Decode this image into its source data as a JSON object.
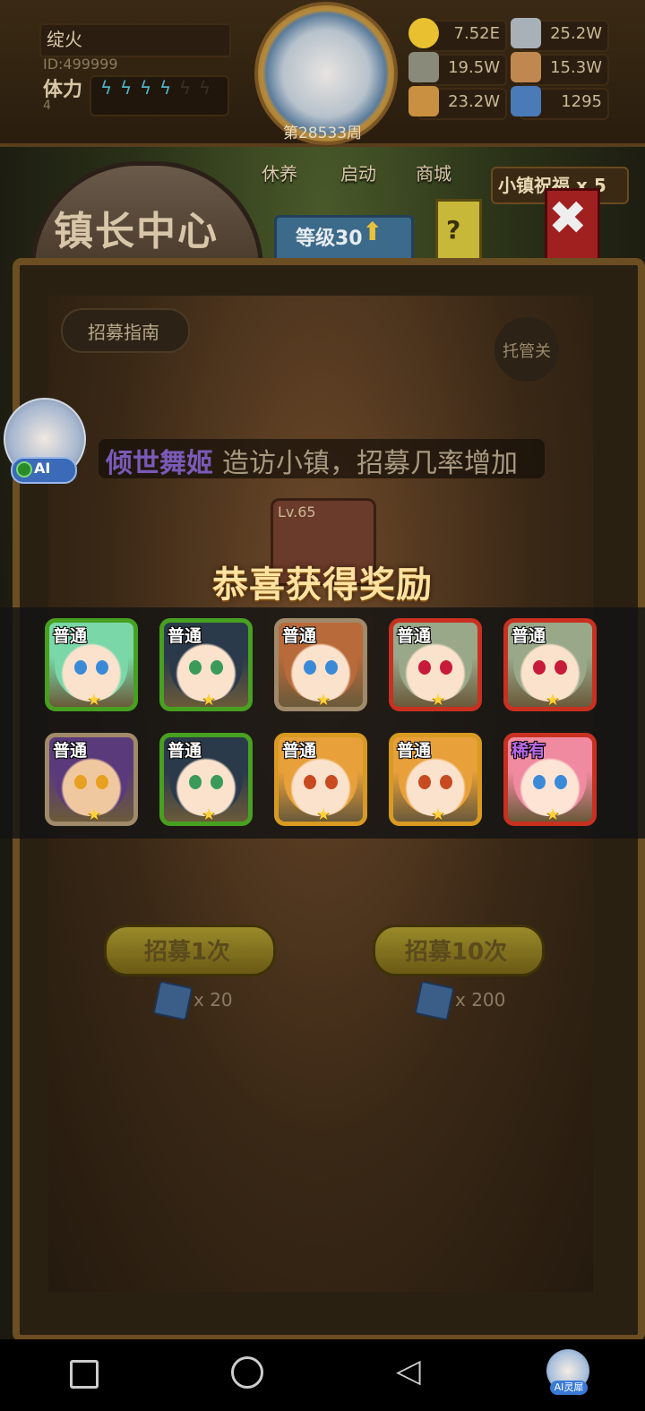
{
  "player": {
    "name": "绽火",
    "id": "ID:499999",
    "stamina_label": "体力",
    "stamina_value": "4",
    "stamina_bolts": 4,
    "stamina_max": 6
  },
  "week": "第28533周",
  "resources": [
    {
      "icon": "gold-coin-icon",
      "value": "7.52E"
    },
    {
      "icon": "steel-ingot-icon",
      "value": "25.2W"
    },
    {
      "icon": "stone-ore-icon",
      "value": "19.5W"
    },
    {
      "icon": "leather-icon",
      "value": "15.3W"
    },
    {
      "icon": "wood-log-icon",
      "value": "23.2W"
    },
    {
      "icon": "blue-gem-icon",
      "value": "1295"
    }
  ],
  "menu": {
    "tabs": [
      "休养",
      "启动",
      "商城"
    ],
    "blessing": "小镇祝福 x 5"
  },
  "panel": {
    "title": "镇长中心",
    "level": "等级30",
    "help": "?",
    "close": "✖",
    "guide": "招募指南",
    "auto": "托管关",
    "banner_hero": "倾世舞姬",
    "banner_text": "造访小镇，招募几率增加",
    "hero_level": "Lv.65",
    "recruit_once": "招募1次",
    "recruit_ten": "招募10次",
    "cost_once": "x 20",
    "cost_ten": "x 200"
  },
  "ai_badge": "AI",
  "reward": {
    "title": "恭喜获得奖励",
    "items": [
      {
        "rarity": "普通",
        "frame": "#48a020",
        "hair": "#7ad8a8",
        "eye": "#3a8ad8",
        "skin": "#fbe2cc",
        "stars": "★"
      },
      {
        "rarity": "普通",
        "frame": "#48a020",
        "hair": "#2a3a4a",
        "eye": "#3a9a5a",
        "skin": "#fbe2cc",
        "stars": "★"
      },
      {
        "rarity": "普通",
        "frame": "#a08a6a",
        "hair": "#b86a3a",
        "eye": "#3a8ad8",
        "skin": "#fbe2cc",
        "stars": "★"
      },
      {
        "rarity": "普通",
        "frame": "#c83020",
        "hair": "#9aa88a",
        "eye": "#c81a3a",
        "skin": "#fbe2cc",
        "stars": "★"
      },
      {
        "rarity": "普通",
        "frame": "#c83020",
        "hair": "#9aa88a",
        "eye": "#c81a3a",
        "skin": "#fbe2cc",
        "stars": "★"
      },
      {
        "rarity": "普通",
        "frame": "#a08a6a",
        "hair": "#5a3a7a",
        "eye": "#e8a020",
        "skin": "#f0c8a0",
        "stars": "★"
      },
      {
        "rarity": "普通",
        "frame": "#48a020",
        "hair": "#2a3a4a",
        "eye": "#3a9a5a",
        "skin": "#fbe2cc",
        "stars": "★"
      },
      {
        "rarity": "普通",
        "frame": "#d89a20",
        "hair": "#e8a03a",
        "eye": "#c84a20",
        "skin": "#fbe2cc",
        "stars": "★"
      },
      {
        "rarity": "普通",
        "frame": "#d89a20",
        "hair": "#e8a03a",
        "eye": "#c84a20",
        "skin": "#fbe2cc",
        "stars": "★"
      },
      {
        "rarity": "稀有",
        "frame": "#c83020",
        "hair": "#f08aa0",
        "eye": "#3a8ad8",
        "skin": "#fde4d4",
        "stars": "★",
        "label_color": "#b86ae8"
      }
    ]
  },
  "nav": {
    "ai_label": "AI灵犀"
  }
}
